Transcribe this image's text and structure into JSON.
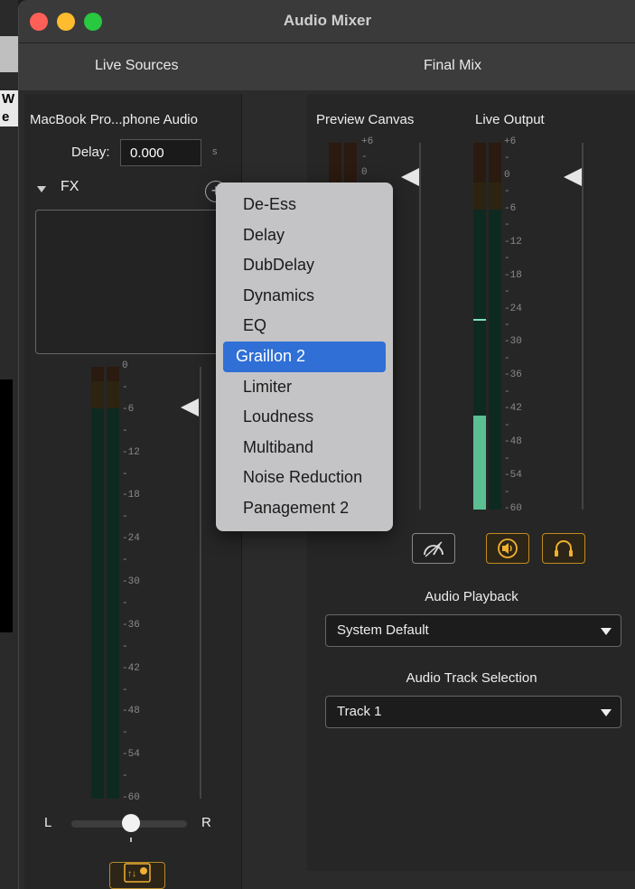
{
  "window": {
    "title": "Audio Mixer"
  },
  "background": {
    "fragment_text": "W\ne"
  },
  "tabs": [
    {
      "label": "Live Sources"
    },
    {
      "label": "Final Mix"
    }
  ],
  "source": {
    "name": "MacBook Pro...phone Audio",
    "delay_label": "Delay:",
    "delay_value": "0.000",
    "delay_unit": "s",
    "fx_label": "FX",
    "fx_add_symbol": "+"
  },
  "source_meter": {
    "ticks": [
      "0",
      "-",
      "-6",
      "-",
      "-12",
      "-",
      "-18",
      "-",
      "-24",
      "-",
      "-30",
      "-",
      "-36",
      "-",
      "-42",
      "-",
      "-48",
      "-",
      "-54",
      "-",
      "-60"
    ],
    "level_fraction": 0.0,
    "fader_db": -6
  },
  "pan": {
    "left_label": "L",
    "right_label": "R",
    "value": 0.5
  },
  "preview": {
    "label": "Preview Canvas",
    "ticks": [
      "+6",
      "-",
      "0"
    ]
  },
  "live_output": {
    "label": "Live Output",
    "ticks": [
      "+6",
      "-",
      "0",
      "-",
      "-6",
      "-",
      "-12",
      "-",
      "-18",
      "-",
      "-24",
      "-",
      "-30",
      "-",
      "-36",
      "-",
      "-42",
      "-",
      "-48",
      "-",
      "-54",
      "-",
      "-60"
    ],
    "level_fraction": 0.255,
    "peak_fraction": 0.52,
    "fader_db": 0
  },
  "audio_playback": {
    "label": "Audio Playback",
    "selected": "System Default"
  },
  "audio_track": {
    "label": "Audio Track Selection",
    "selected": "Track 1"
  },
  "fx_menu": {
    "items": [
      {
        "label": "De-Ess"
      },
      {
        "label": "Delay"
      },
      {
        "label": "DubDelay"
      },
      {
        "label": "Dynamics"
      },
      {
        "label": "EQ"
      },
      {
        "label": "Graillon 2",
        "selected": true
      },
      {
        "label": "Limiter"
      },
      {
        "label": "Loudness"
      },
      {
        "label": "Multiband"
      },
      {
        "label": "Noise Reduction"
      },
      {
        "label": "Panagement 2"
      }
    ]
  },
  "colors": {
    "close": "#fe5f57",
    "minimize": "#febc2e",
    "zoom": "#28c840",
    "meter_green": "#5bbf93",
    "accent_orange": "#f0b030",
    "menu_selected": "#2f6fd6"
  },
  "icons": {
    "meter_toggle": "gauge-icon",
    "speaker": "speaker-icon",
    "headphones": "headphones-icon",
    "mixer_settings": "mixer-settings-icon"
  }
}
